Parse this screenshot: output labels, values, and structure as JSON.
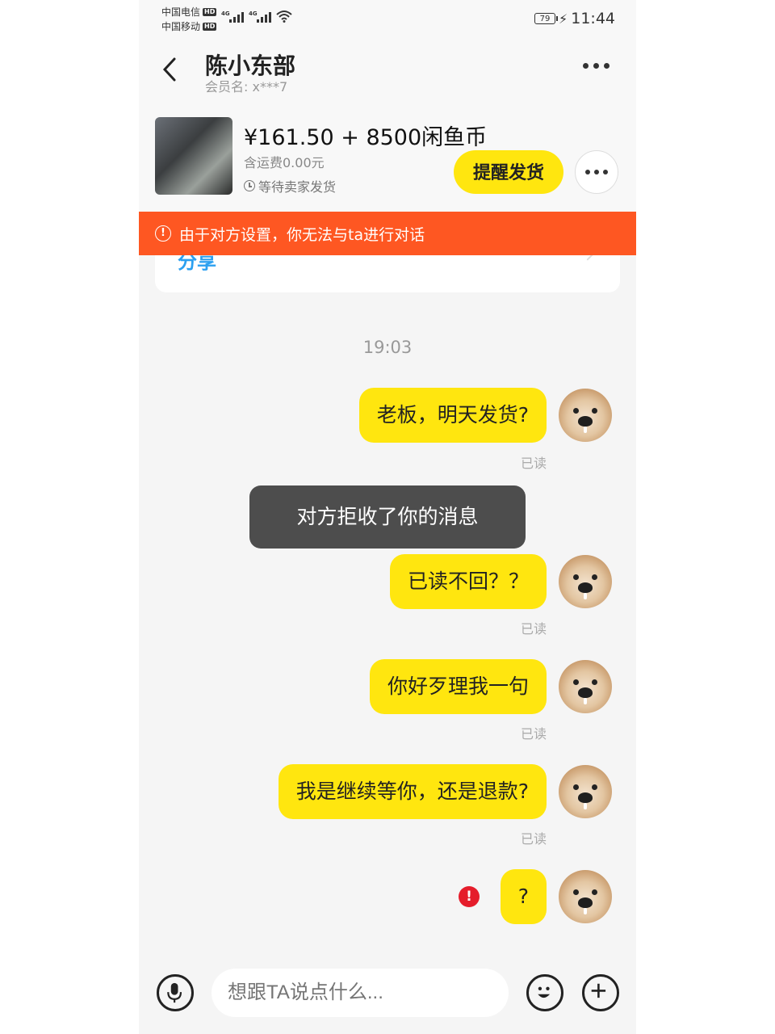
{
  "status_bar": {
    "carrier1": "中国电信",
    "carrier2": "中国移动",
    "hd": "HD",
    "net": "4G",
    "battery": "79",
    "time": "11:44"
  },
  "header": {
    "title": "陈小东部",
    "member": "会员名:  x***7"
  },
  "product": {
    "price": "¥161.50 + 8500闲鱼币",
    "shipping": "含运费0.00元",
    "status": "等待卖家发货",
    "remind_label": "提醒发货"
  },
  "banner": {
    "icon_text": "!",
    "text": "由于对方设置，你无法与ta进行对话"
  },
  "peek_card": {
    "text": "分享"
  },
  "chat": {
    "timestamp": "19:03",
    "messages": [
      {
        "text": "老板，明天发货?",
        "status": "已读"
      },
      {
        "text": "已读不回？？",
        "status": "已读"
      },
      {
        "text": "你好歹理我一句",
        "status": "已读"
      },
      {
        "text": "我是继续等你，还是退款?",
        "status": "已读"
      },
      {
        "text": "?",
        "status": ""
      }
    ],
    "error_icon_text": "!"
  },
  "toast": {
    "text": "对方拒收了你的消息"
  },
  "input": {
    "placeholder": "想跟TA说点什么..."
  },
  "colors": {
    "accent": "#ffe60f",
    "banner": "#fe5722",
    "error": "#e51d2b"
  }
}
